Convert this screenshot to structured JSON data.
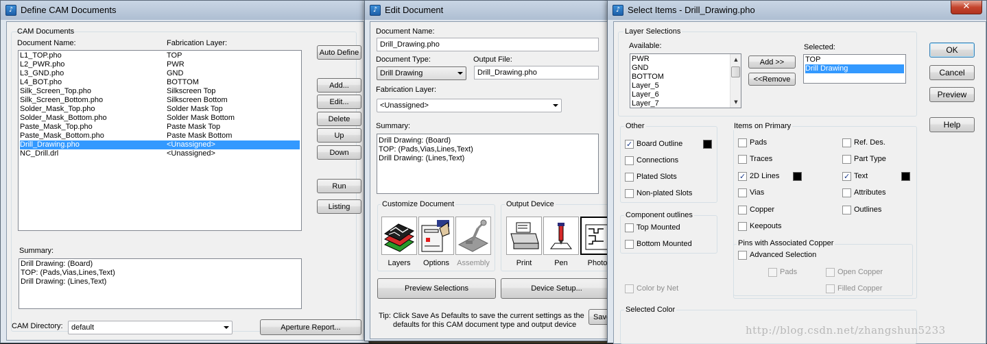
{
  "cam_window": {
    "title": "Define CAM Documents",
    "group_title": "CAM Documents",
    "col_name_header": "Document Name:",
    "col_layer_header": "Fabrication Layer:",
    "documents": [
      {
        "name": "L1_TOP.pho",
        "layer": "TOP"
      },
      {
        "name": "L2_PWR.pho",
        "layer": "PWR"
      },
      {
        "name": "L3_GND.pho",
        "layer": "GND"
      },
      {
        "name": "L4_BOT.pho",
        "layer": "BOTTOM"
      },
      {
        "name": "Silk_Screen_Top.pho",
        "layer": "Silkscreen Top"
      },
      {
        "name": "Silk_Screen_Bottom.pho",
        "layer": "Silkscreen Bottom"
      },
      {
        "name": "Solder_Mask_Top.pho",
        "layer": "Solder Mask Top"
      },
      {
        "name": "Solder_Mask_Bottom.pho",
        "layer": "Solder Mask Bottom"
      },
      {
        "name": "Paste_Mask_Top.pho",
        "layer": "Paste Mask Top"
      },
      {
        "name": "Paste_Mask_Bottom.pho",
        "layer": "Paste Mask Bottom"
      },
      {
        "name": "Drill_Drawing.pho",
        "layer": "<Unassigned>"
      },
      {
        "name": "NC_Drill.drl",
        "layer": "<Unassigned>"
      }
    ],
    "selected_index": 10,
    "buttons": {
      "auto_define": "Auto Define",
      "add": "Add...",
      "edit": "Edit...",
      "delete": "Delete",
      "up": "Up",
      "down": "Down",
      "run": "Run",
      "listing": "Listing",
      "aperture_report": "Aperture Report..."
    },
    "summary_label": "Summary:",
    "summary_lines": [
      "Drill Drawing: (Board)",
      "TOP: (Pads,Vias,Lines,Text)",
      "Drill Drawing: (Lines,Text)"
    ],
    "cam_directory_label": "CAM Directory:",
    "cam_directory_value": "default"
  },
  "edit_window": {
    "title": "Edit Document",
    "doc_name_label": "Document Name:",
    "doc_name_value": "Drill_Drawing.pho",
    "doc_type_label": "Document Type:",
    "doc_type_value": "Drill Drawing",
    "output_file_label": "Output File:",
    "output_file_value": "Drill_Drawing.pho",
    "fab_layer_label": "Fabrication Layer:",
    "fab_layer_value": "<Unassigned>",
    "summary_label": "Summary:",
    "summary_lines": [
      "Drill Drawing: (Board)",
      "TOP: (Pads,Vias,Lines,Text)",
      "Drill Drawing: (Lines,Text)"
    ],
    "customize_label": "Customize Document",
    "customize_tools": [
      "Layers",
      "Options",
      "Assembly"
    ],
    "output_device_label": "Output Device",
    "device_tools": [
      "Print",
      "Pen",
      "Photo"
    ],
    "preview_button": "Preview Selections",
    "device_setup_button": "Device Setup...",
    "tip_text": "Tip: Click Save As Defaults to save the current settings as the",
    "tip_text2": "defaults for this CAM document type and output device",
    "save_button_partial": "Save"
  },
  "select_window": {
    "title": "Select Items - Drill_Drawing.pho",
    "layer_selections_label": "Layer Selections",
    "available_label": "Available:",
    "available_items": [
      "PWR",
      "GND",
      "BOTTOM",
      "Layer_5",
      "Layer_6",
      "Layer_7"
    ],
    "selected_label": "Selected:",
    "selected_items": [
      "TOP",
      "Drill Drawing"
    ],
    "selected_highlight_index": 1,
    "add_button": "Add >>",
    "remove_button": "<<Remove",
    "ok_button": "OK",
    "cancel_button": "Cancel",
    "preview_button": "Preview",
    "help_button": "Help",
    "other_label": "Other",
    "other_items": [
      {
        "label": "Board Outline",
        "checked": true,
        "color": true
      },
      {
        "label": "Connections",
        "checked": false
      },
      {
        "label": "Plated Slots",
        "checked": false
      },
      {
        "label": "Non-plated Slots",
        "checked": false
      }
    ],
    "component_outlines_label": "Component outlines",
    "component_items": [
      {
        "label": "Top Mounted",
        "checked": false
      },
      {
        "label": "Bottom Mounted",
        "checked": false
      }
    ],
    "color_by_net_label": "Color by Net",
    "items_on_primary_label": "Items on Primary",
    "primary_left": [
      {
        "label": "Pads",
        "checked": false
      },
      {
        "label": "Traces",
        "checked": false
      },
      {
        "label": "2D Lines",
        "checked": true,
        "color": true
      },
      {
        "label": "Vias",
        "checked": false
      },
      {
        "label": "Copper",
        "checked": false
      },
      {
        "label": "Keepouts",
        "checked": false
      }
    ],
    "primary_right": [
      {
        "label": "Ref. Des.",
        "checked": false
      },
      {
        "label": "Part Type",
        "checked": false
      },
      {
        "label": "Text",
        "checked": true,
        "color": true
      },
      {
        "label": "Attributes",
        "checked": false
      },
      {
        "label": "Outlines",
        "checked": false
      }
    ],
    "pins_label": "Pins with Associated Copper",
    "advanced_selection_label": "Advanced Selection",
    "pins_pads_label": "Pads",
    "open_copper_label": "Open Copper",
    "filled_copper_label": "Filled Copper",
    "selected_color_label": "Selected Color"
  },
  "watermark": "http://blog.csdn.net/zhangshun5233"
}
